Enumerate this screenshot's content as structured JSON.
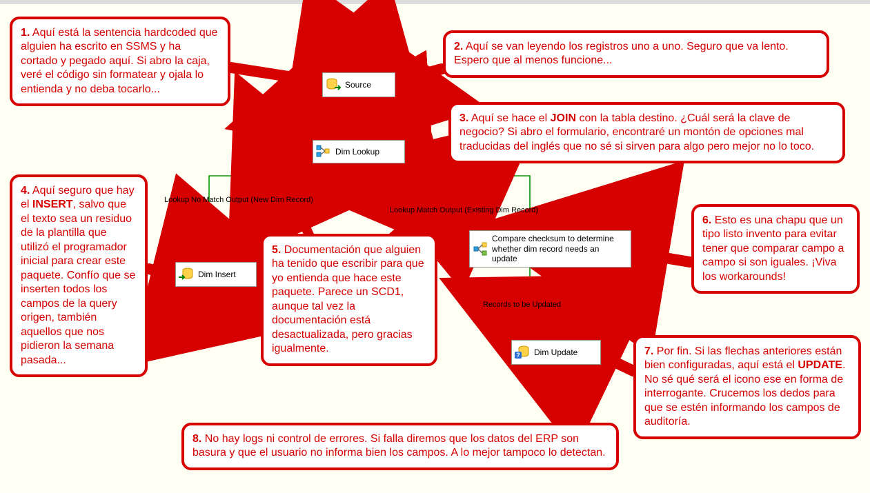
{
  "nodes": {
    "source": {
      "label": "Source"
    },
    "lookup": {
      "label": "Dim Lookup"
    },
    "insert": {
      "label": "Dim Insert"
    },
    "compare": {
      "label": "Compare checksum to determine whether dim record needs an update"
    },
    "update": {
      "label": "Dim Update"
    }
  },
  "flow_labels": {
    "no_match": "Lookup No Match Output (New Dim Record)",
    "match": "Lookup Match Output (Existing Dim Record)",
    "to_update": "Records to be Updated"
  },
  "callouts": {
    "1": {
      "num": "1.",
      "text": "Aquí está la sentencia hardcoded que alguien ha escrito en SSMS y ha cortado y pegado aquí. Si abro la caja, veré el código sin formatear y ojala lo entienda y no deba tocarlo..."
    },
    "2": {
      "num": "2.",
      "text": "Aquí se van leyendo los registros  uno a uno. Seguro que va lento. Espero que al menos funcione..."
    },
    "3": {
      "num": "3.",
      "text_html": "Aquí se hace el <b>JOIN</b> con la tabla destino. ¿Cuál será la clave de negocio? Si abro el formulario, encontraré un montón de opciones mal traducidas del inglés que no sé si sirven para algo pero mejor no lo toco."
    },
    "4": {
      "num": "4.",
      "text_html": "Aquí seguro que hay el <b>INSERT</b>, salvo que el texto sea un residuo de la plantilla que utilizó el programador inicial para  crear este paquete. Confío que se inserten todos los campos de la query origen, también aquellos que nos pidieron la semana pasada..."
    },
    "5": {
      "num": "5.",
      "text": "Documentación que alguien ha tenido que escribir para que yo entienda que hace este paquete. Parece un SCD1, aunque tal vez la documentación está desactualizada, pero gracias igualmente."
    },
    "6": {
      "num": "6.",
      "text": "Esto es una chapu que un tipo listo invento para evitar tener que comparar campo a campo si son iguales. ¡Viva los  workarounds!"
    },
    "7": {
      "num": "7.",
      "text_html": "Por fin. Si las flechas anteriores están bien configuradas, aquí está el <b>UPDATE</b>. No sé qué será el icono ese en forma de interrogante. Crucemos los dedos para que se estén informando los campos de auditoría."
    },
    "8": {
      "num": "8.",
      "text": "No hay logs ni control de errores. Si falla diremos  que los datos del ERP son basura y que el usuario no informa bien los campos. A lo mejor tampoco lo detectan."
    }
  }
}
